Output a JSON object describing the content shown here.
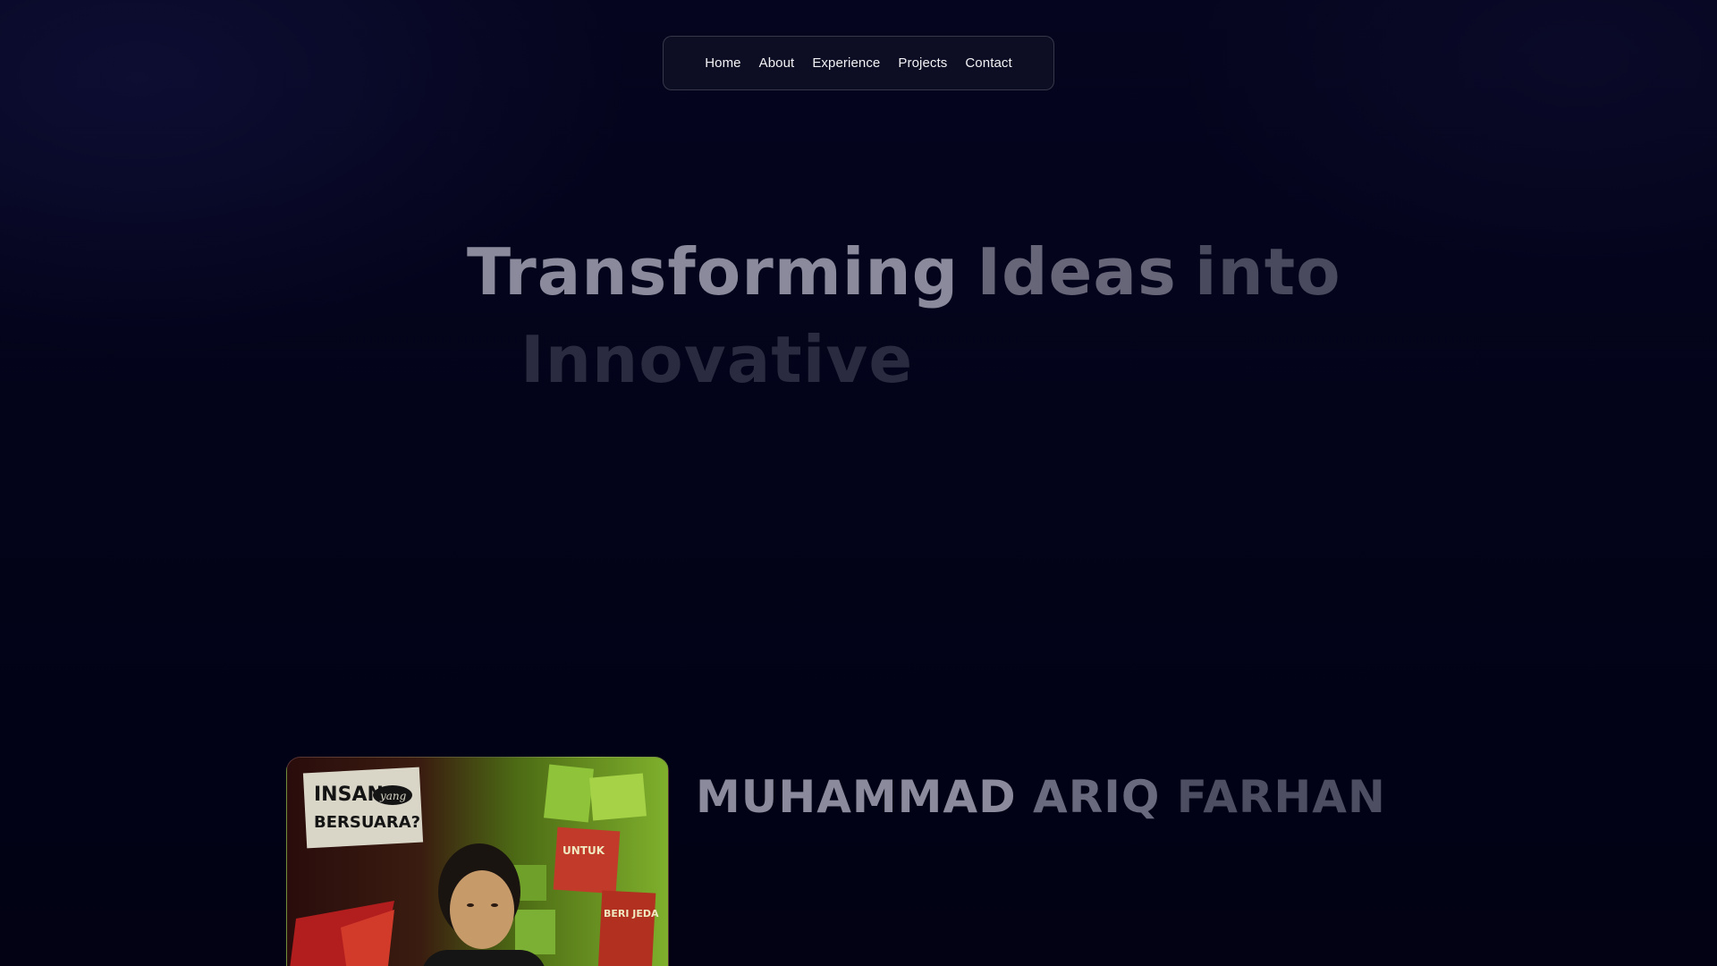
{
  "nav": {
    "items": [
      {
        "label": "Home"
      },
      {
        "label": "About"
      },
      {
        "label": "Experience"
      },
      {
        "label": "Projects"
      },
      {
        "label": "Contact"
      }
    ]
  },
  "hero": {
    "line1": [
      "Transforming",
      "Ideas",
      "into"
    ],
    "line2": [
      "Innovative"
    ]
  },
  "about": {
    "name_words": [
      "MUHAMMAD",
      "ARIQ",
      "FARHAN"
    ],
    "photo": {
      "poster_title_1": "INSAN",
      "poster_title_small": "yang",
      "poster_title_2": "BERSUARA?",
      "poster_right_1": "BERI JEDA",
      "poster_right_2": "UNTUK"
    }
  },
  "colors": {
    "background": "#03031a",
    "nav_bg": "#14162a",
    "text": "#f2f2f6"
  }
}
